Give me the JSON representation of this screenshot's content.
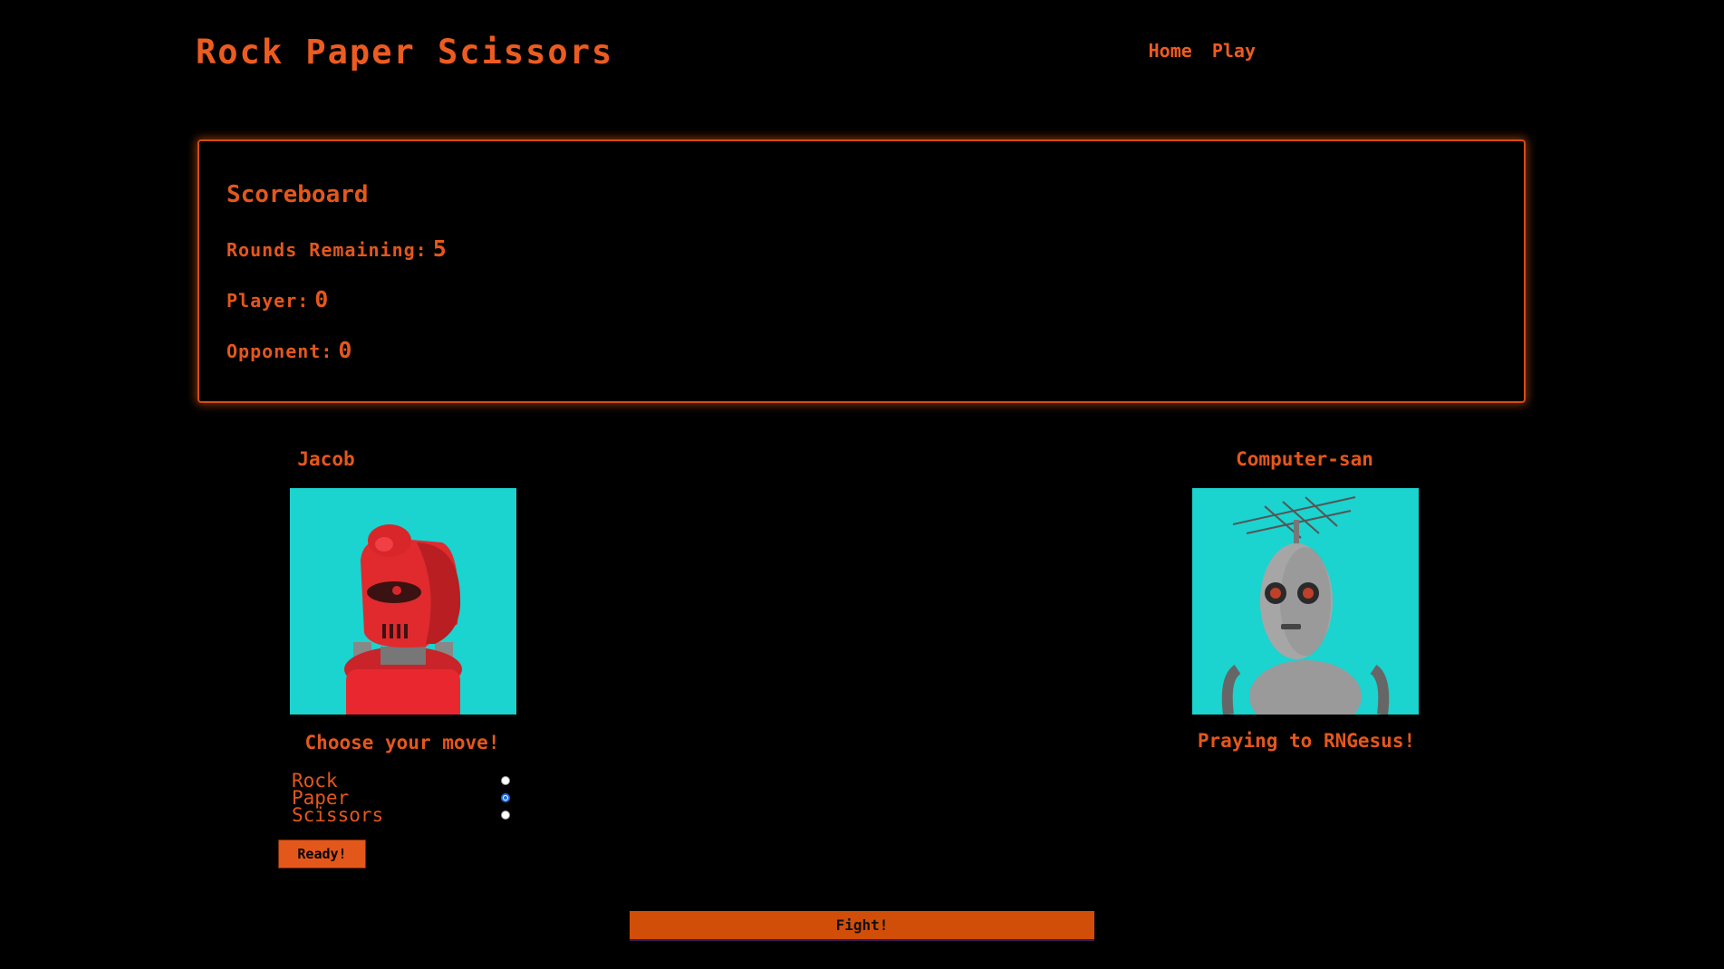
{
  "header": {
    "title": "Rock Paper Scissors",
    "nav": [
      "Home",
      "Play"
    ]
  },
  "scoreboard": {
    "title": "Scoreboard",
    "rounds_label": "Rounds Remaining:",
    "rounds_value": "5",
    "player_label": "Player:",
    "player_value": "0",
    "opponent_label": "Opponent:",
    "opponent_value": "0"
  },
  "player": {
    "name": "Jacob",
    "avatar": "red-robot-avatar",
    "prompt": "Choose your move!"
  },
  "opponent": {
    "name": "Computer-san",
    "avatar": "gray-robot-avatar",
    "status": "Praying to RNGesus!"
  },
  "moves": [
    {
      "label": "Rock",
      "checked": false
    },
    {
      "label": "Paper",
      "checked": true
    },
    {
      "label": "Scissors",
      "checked": false
    }
  ],
  "buttons": {
    "ready": "Ready!",
    "fight": "Fight!"
  },
  "colors": {
    "accent": "#e4571b",
    "background": "#000000",
    "avatar_bg": "#1bd3cf"
  }
}
